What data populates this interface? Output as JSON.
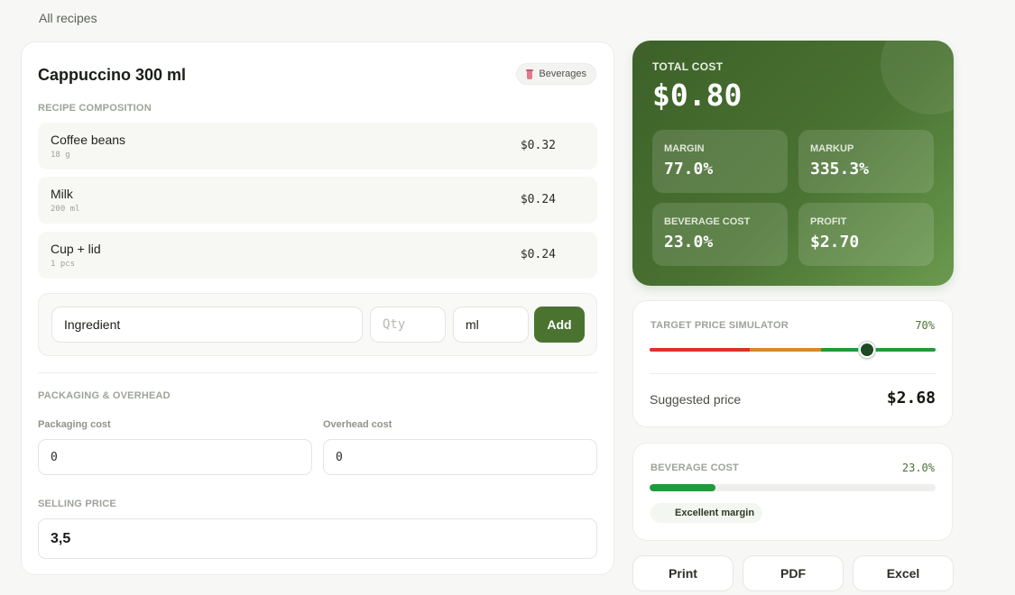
{
  "nav": {
    "breadcrumb": "All recipes"
  },
  "recipe": {
    "title": "Cappuccino 300 ml",
    "category": "Beverages",
    "composition_label": "RECIPE COMPOSITION",
    "ingredients": [
      {
        "name": "Coffee beans",
        "qty": "18 g",
        "cost": "$0.32"
      },
      {
        "name": "Milk",
        "qty": "200 ml",
        "cost": "$0.24"
      },
      {
        "name": "Cup + lid",
        "qty": "1 pcs",
        "cost": "$0.24"
      }
    ]
  },
  "add_form": {
    "ingredient_value": "Ingredient",
    "qty_placeholder": "Qty",
    "unit_value": "ml",
    "add_label": "Add"
  },
  "overhead": {
    "section_label": "PACKAGING & OVERHEAD",
    "packaging_label": "Packaging cost",
    "packaging_value": "0",
    "overhead_label": "Overhead cost",
    "overhead_value": "0"
  },
  "selling": {
    "label": "SELLING PRICE",
    "value": "3,5"
  },
  "summary": {
    "total_label": "TOTAL COST",
    "total_value": "$0.80",
    "stats": [
      {
        "label": "MARGIN",
        "value": "77.0%"
      },
      {
        "label": "MARKUP",
        "value": "335.3%"
      },
      {
        "label": "BEVERAGE COST",
        "value": "23.0%"
      },
      {
        "label": "PROFIT",
        "value": "$2.70"
      }
    ]
  },
  "simulator": {
    "label": "TARGET PRICE SIMULATOR",
    "target_pct": "70%",
    "slider_level": 0.76,
    "segment_colors": [
      "#d8322f",
      "#d68a26",
      "#1f9a3c"
    ],
    "suggested_label": "Suggested price",
    "suggested_value": "$2.68"
  },
  "beverage_cost": {
    "label": "BEVERAGE COST",
    "pct": "23.0%",
    "fill_fraction": 0.23,
    "status": "Excellent margin"
  },
  "actions": {
    "print": "Print",
    "pdf": "PDF",
    "excel": "Excel"
  },
  "colors": {
    "brand_green": "#4b7330",
    "good_green": "#1f9a3c"
  }
}
